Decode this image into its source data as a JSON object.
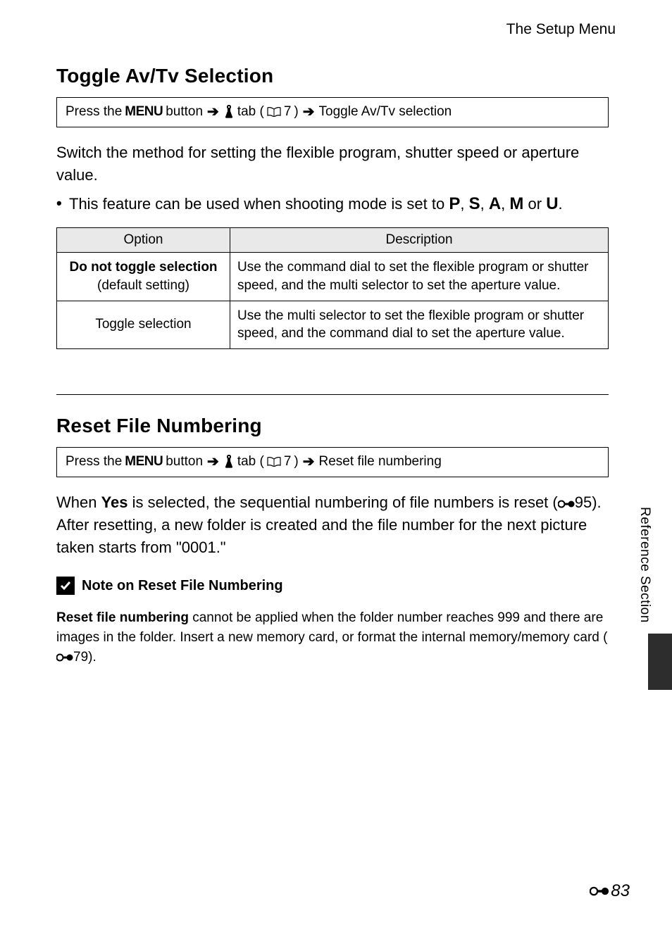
{
  "header": {
    "chapter": "The Setup Menu"
  },
  "section1": {
    "title": "Toggle Av/Tv Selection",
    "nav": {
      "press_the": "Press the",
      "menu_word": "MENU",
      "button": "button",
      "tab_before": "tab (",
      "tab_ref": "7",
      "tab_after": ")",
      "dest": "Toggle Av/Tv selection"
    },
    "intro": "Switch the method for setting the flexible program, shutter speed or aperture value.",
    "bullet_prefix": "This feature can be used when shooting mode is set to ",
    "modes": [
      "P",
      "S",
      "A",
      "M",
      "U"
    ],
    "bullet_suffix": ".",
    "table": {
      "head_option": "Option",
      "head_desc": "Description",
      "rows": [
        {
          "option_bold": "Do not toggle selection",
          "option_sub": "(default setting)",
          "desc": "Use the command dial to set the flexible program or shutter speed, and the multi selector to set the aperture value."
        },
        {
          "option_bold": "Toggle selection",
          "option_sub": "",
          "desc": "Use the multi selector to set the flexible program or shutter speed, and the command dial to set the aperture value."
        }
      ]
    }
  },
  "section2": {
    "title": "Reset File Numbering",
    "nav": {
      "press_the": "Press the",
      "menu_word": "MENU",
      "button": "button",
      "tab_before": "tab (",
      "tab_ref": "7",
      "tab_after": ")",
      "dest": "Reset file numbering"
    },
    "para_before_yes": "When ",
    "para_yes": "Yes",
    "para_after_yes_1": " is selected, the sequential numbering of file numbers is reset (",
    "para_ref": "95",
    "para_after_yes_2": "). After resetting, a new folder is created and the file number for the next picture taken starts from \"0001.\"",
    "note": {
      "title": "Note on Reset File Numbering",
      "body_bold": "Reset file numbering",
      "body_rest_1": " cannot be applied when the folder number reaches 999 and there are images in the folder. Insert a new memory card, or format the internal memory/memory card (",
      "body_ref": "79",
      "body_rest_2": ")."
    }
  },
  "side": {
    "label": "Reference Section"
  },
  "page_number": "83"
}
